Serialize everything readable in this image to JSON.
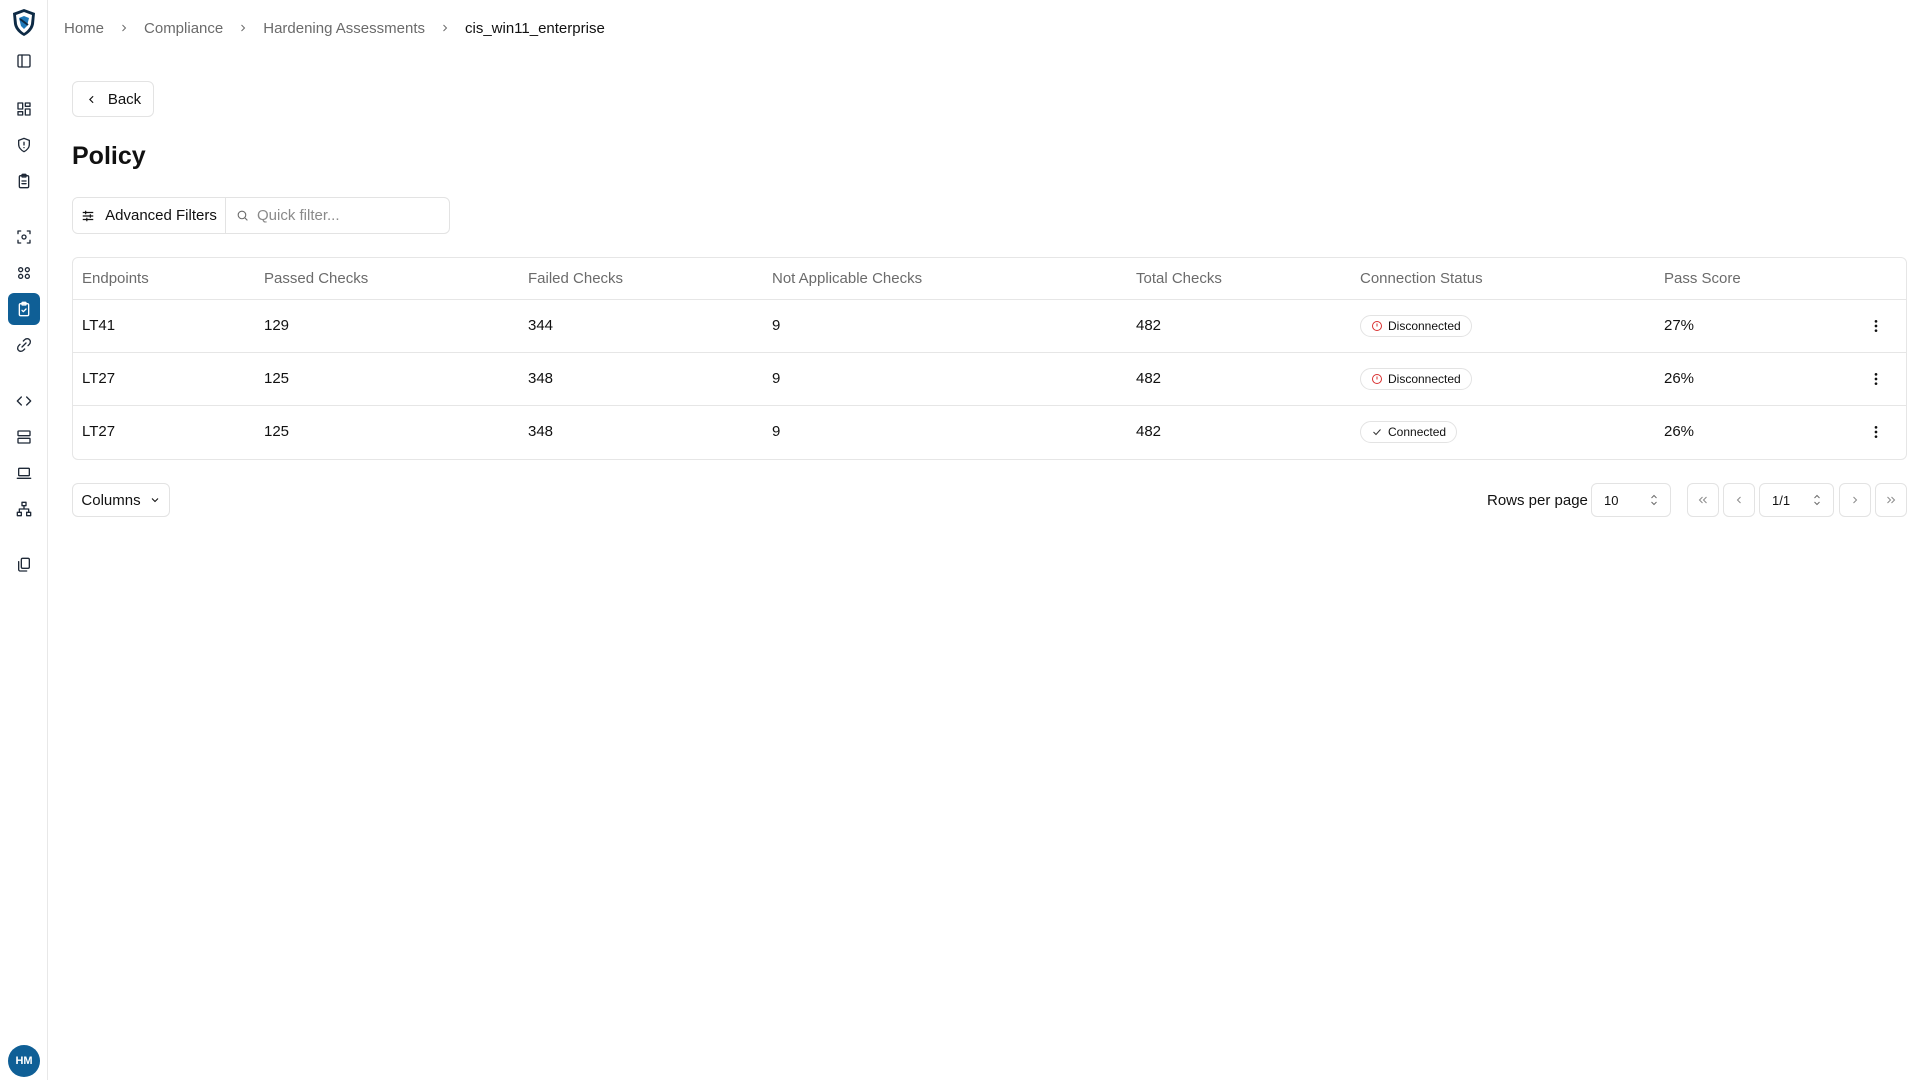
{
  "breadcrumb": [
    "Home",
    "Compliance",
    "Hardening Assessments",
    "cis_win11_enterprise"
  ],
  "back_label": "Back",
  "page_title": "Policy",
  "filters": {
    "advanced_label": "Advanced Filters",
    "quick_placeholder": "Quick filter..."
  },
  "table": {
    "headers": [
      "Endpoints",
      "Passed Checks",
      "Failed Checks",
      "Not Applicable Checks",
      "Total Checks",
      "Connection Status",
      "Pass Score"
    ],
    "rows": [
      {
        "endpoint": "LT41",
        "passed": "129",
        "failed": "344",
        "not_applicable": "9",
        "total": "482",
        "status": "Disconnected",
        "score": "27%"
      },
      {
        "endpoint": "LT27",
        "passed": "125",
        "failed": "348",
        "not_applicable": "9",
        "total": "482",
        "status": "Disconnected",
        "score": "26%"
      },
      {
        "endpoint": "LT27",
        "passed": "125",
        "failed": "348",
        "not_applicable": "9",
        "total": "482",
        "status": "Connected",
        "score": "26%"
      }
    ]
  },
  "footer": {
    "columns_label": "Columns",
    "rows_per_page_label": "Rows per page",
    "rows_per_page_value": "10",
    "page_value": "1/1"
  },
  "user": {
    "initials": "HM"
  },
  "colors": {
    "accent": "#0f5f96",
    "disconnected": "#d93030",
    "connected": "#333333"
  },
  "sidebar_icons": [
    "panel-toggle-icon",
    "dashboard-icon",
    "shield-icon",
    "clipboard-icon",
    "scan-icon",
    "assets-icon",
    "compliance-icon",
    "integrations-icon",
    "code-icon",
    "server-icon",
    "laptop-icon",
    "network-icon",
    "reports-icon"
  ]
}
